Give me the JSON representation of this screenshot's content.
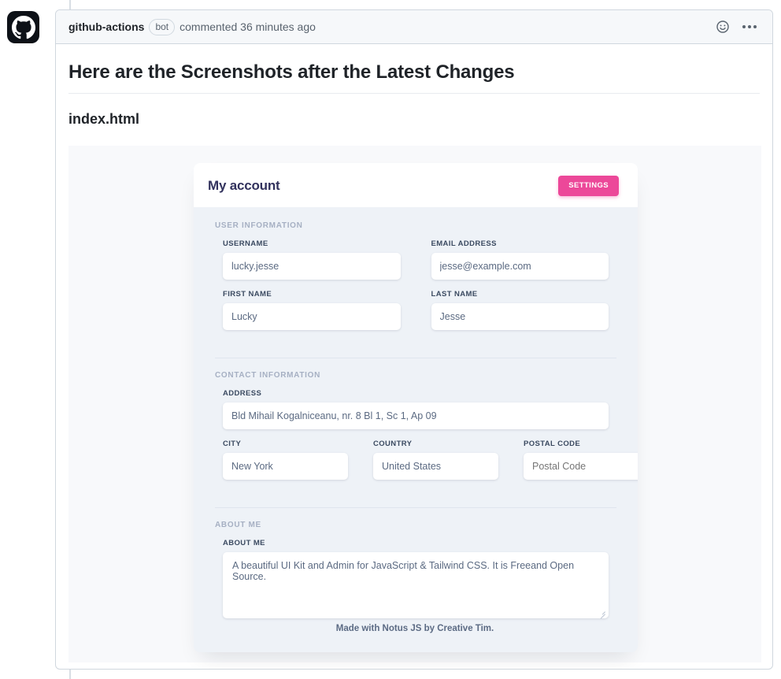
{
  "github": {
    "author": "github-actions",
    "bot_badge": "bot",
    "commented": "commented 36 minutes ago",
    "reaction_icon": "smiley-icon",
    "menu_icon": "kebab-horizontal-icon",
    "avatar_icon": "github-octocat-icon"
  },
  "markdown": {
    "heading": "Here are the Screenshots after the Latest Changes",
    "subheading": "index.html"
  },
  "screenshot": {
    "card": {
      "title": "My account",
      "settings_label": "Settings",
      "sections": [
        {
          "id": "user-information",
          "title": "User Information",
          "rows": [
            [
              {
                "name": "username",
                "label": "Username",
                "value": "lucky.jesse",
                "is_placeholder": false
              },
              {
                "name": "email-address",
                "label": "Email address",
                "value": "jesse@example.com",
                "is_placeholder": false
              }
            ],
            [
              {
                "name": "first-name",
                "label": "First Name",
                "value": "Lucky",
                "is_placeholder": false
              },
              {
                "name": "last-name",
                "label": "Last Name",
                "value": "Jesse",
                "is_placeholder": false
              }
            ]
          ]
        },
        {
          "id": "contact-information",
          "title": "Contact Information",
          "address": {
            "name": "address",
            "label": "Address",
            "value": "Bld Mihail Kogalniceanu, nr. 8 Bl 1, Sc 1, Ap 09",
            "is_placeholder": false
          },
          "trio": [
            {
              "name": "city",
              "label": "City",
              "value": "New York",
              "is_placeholder": false
            },
            {
              "name": "country",
              "label": "Country",
              "value": "United States",
              "is_placeholder": false
            },
            {
              "name": "postal-code",
              "label": "Postal Code",
              "value": "Postal Code",
              "is_placeholder": true
            }
          ]
        },
        {
          "id": "about-me",
          "title": "About Me",
          "textarea": {
            "name": "about-me",
            "label": "About me",
            "value": "A beautiful UI Kit and Admin for JavaScript & Tailwind CSS. It is Freeand Open Source.",
            "is_placeholder": false
          }
        }
      ]
    },
    "footer": "Made with Notus JS by Creative Tim."
  },
  "colors": {
    "accent_pink": "#ec4899",
    "card_body": "#eef2f7",
    "shot_background": "#f8f9fb",
    "title_text": "#32325d",
    "label_text": "#3b4a61",
    "section_text": "#a6b0c3"
  }
}
